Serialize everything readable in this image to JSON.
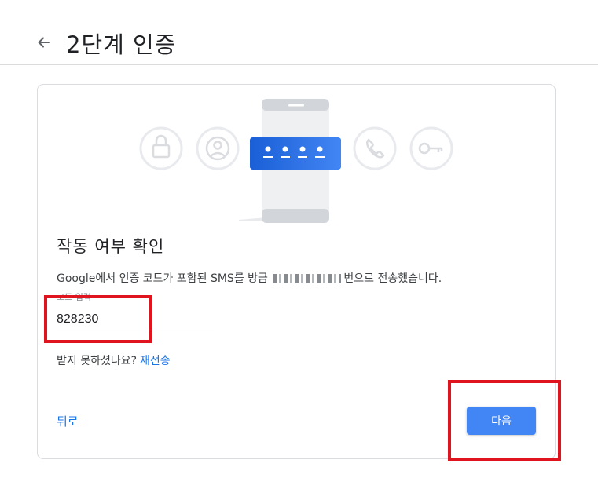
{
  "header": {
    "title": "2단계 인증",
    "back_icon": "arrow-left-icon"
  },
  "card": {
    "illustration": {
      "icons": [
        "lock-icon",
        "person-icon",
        "phone-icon",
        "phone-call-icon",
        "key-icon"
      ],
      "code_dots": 4
    },
    "section_title": "작동 여부 확인",
    "description_prefix": "Google에서 인증 코드가 포함된 SMS를 방금",
    "description_suffix": "번으로 전송했습니다.",
    "code_field": {
      "label": "코드 입력",
      "value": "828230"
    },
    "resend": {
      "question": "받지 못하셨나요?",
      "link_label": "재전송"
    },
    "back_label": "뒤로",
    "next_label": "다음"
  },
  "colors": {
    "primary_button": "#4285f4",
    "link": "#1a73e8",
    "highlight": "#e0141e"
  }
}
